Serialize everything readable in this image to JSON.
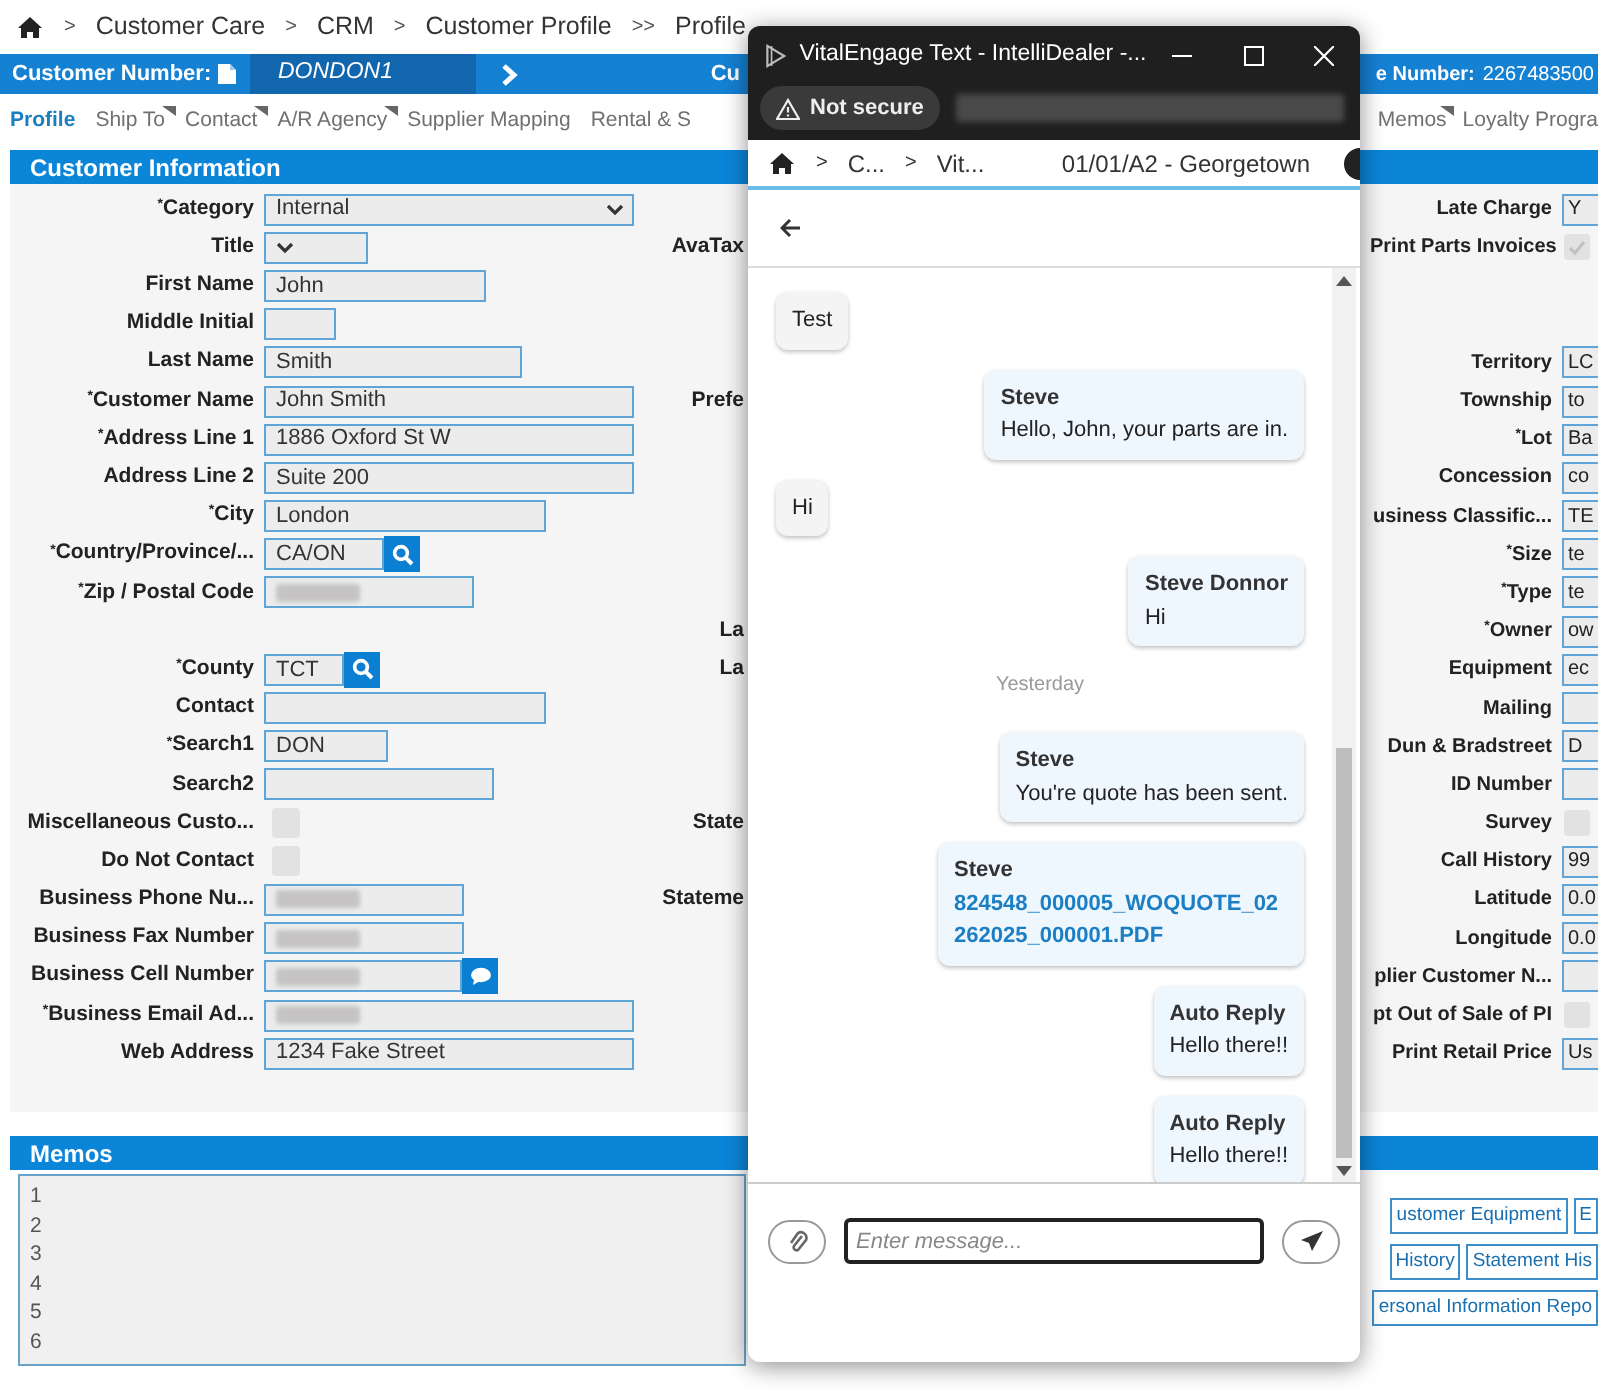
{
  "breadcrumb": [
    {
      "separator": ">",
      "label": "Customer Care"
    },
    {
      "separator": ">",
      "label": "CRM"
    },
    {
      "separator": ">",
      "label": "Customer Profile"
    },
    {
      "separator": ">>",
      "label": "Profile"
    }
  ],
  "customer_bar": {
    "label": "Customer Number:",
    "value": "DONDON1",
    "next_label": "Cu",
    "right_label": "e Number:",
    "right_value": "2267483500"
  },
  "tabs": [
    {
      "label": "Profile",
      "selected": true,
      "has_menu": false
    },
    {
      "label": "Ship To",
      "selected": false,
      "has_menu": true
    },
    {
      "label": "Contact",
      "selected": false,
      "has_menu": true
    },
    {
      "label": "A/R Agency",
      "selected": false,
      "has_menu": true
    },
    {
      "label": "Supplier Mapping",
      "selected": false,
      "has_menu": false
    },
    {
      "label": "Rental & S",
      "selected": false,
      "has_menu": false
    }
  ],
  "tabs_continued": [
    {
      "label": "Memos",
      "selected": false,
      "has_menu": true
    },
    {
      "label": "Loyalty Progra",
      "selected": false,
      "has_menu": false
    }
  ],
  "customer_information": {
    "title": "Customer Information",
    "rows": [
      {
        "left": {
          "label": "$^{*}$Category",
          "kind": "select",
          "value": "Internal"
        },
        "right": {
          "label": "Late Charge",
          "kind": "text",
          "value": "Y"
        }
      },
      {
        "left": {
          "label": "Title",
          "kind": "select"
        },
        "middle": "AvaTax",
        "right": {
          "label": "Print Parts Invoices",
          "kind": "checkbox",
          "checked": true
        }
      },
      {
        "left": {
          "label": "First Name",
          "kind": "text",
          "value": "John"
        }
      },
      {
        "left": {
          "label": "Middle Initial",
          "kind": "text"
        }
      },
      {
        "left": {
          "label": "Last Name",
          "kind": "text",
          "value": "Smith"
        },
        "right": {
          "label": "Territory",
          "kind": "text",
          "value": "LC"
        }
      },
      {
        "left": {
          "label": "$^{*}$Customer Name",
          "kind": "text",
          "value": "John Smith"
        },
        "middle": "Prefe",
        "right": {
          "label": "Township",
          "kind": "text",
          "value": "to"
        }
      },
      {
        "left": {
          "label": "$^{*}$Address Line 1",
          "kind": "text",
          "value": "1886 Oxford St W"
        },
        "right": {
          "label": "$^{*}$Lot",
          "kind": "text",
          "value": "Ba"
        }
      },
      {
        "left": {
          "label": "Address Line 2",
          "kind": "text",
          "value": "Suite 200"
        },
        "right": {
          "label": "Concession",
          "kind": "text",
          "value": "co"
        }
      },
      {
        "left": {
          "label": "$^{*}$City",
          "kind": "text",
          "value": "London"
        },
        "right": {
          "label": "usiness Classific...",
          "kind": "text",
          "value": "TE"
        }
      },
      {
        "left": {
          "label": "$^{*}$Country/Province/...",
          "kind": "lookup",
          "value": "CA/ON"
        },
        "right": {
          "label": "$^{*}$Size",
          "kind": "text",
          "value": "te"
        }
      },
      {
        "left": {
          "label": "$^{*}$Zip / Postal Code",
          "kind": "text",
          "redacted": true
        },
        "right": {
          "label": "$^{*}$Type",
          "kind": "text",
          "value": "te"
        }
      },
      {
        "middle": "La",
        "right": {
          "label": "$^{*}$Owner",
          "kind": "text",
          "value": "ow"
        }
      },
      {
        "left": {
          "label": "$^{*}$County",
          "kind": "lookup",
          "value": "TCT"
        },
        "middle": "La",
        "right": {
          "label": "Equipment",
          "kind": "text",
          "value": "ec"
        }
      },
      {
        "left": {
          "label": "Contact",
          "kind": "text"
        },
        "right": {
          "label": "Mailing",
          "kind": "text"
        }
      },
      {
        "left": {
          "label": "$^{*}$Search1",
          "kind": "text",
          "value": "DON"
        },
        "right": {
          "label": "Dun & Bradstreet",
          "kind": "text",
          "value": "D"
        }
      },
      {
        "left": {
          "label": "Search2",
          "kind": "text"
        },
        "right": {
          "label": "ID Number",
          "kind": "text"
        }
      },
      {
        "left": {
          "label": "Miscellaneous Custo...",
          "kind": "checkbox",
          "checked": false
        },
        "middle": "State",
        "right": {
          "label": "Survey",
          "kind": "checkbox",
          "checked": false
        }
      },
      {
        "left": {
          "label": "Do Not Contact",
          "kind": "checkbox",
          "checked": false
        },
        "right": {
          "label": "Call History",
          "kind": "text",
          "value": "99"
        }
      },
      {
        "left": {
          "label": "Business Phone Nu...",
          "kind": "text",
          "redacted": true
        },
        "middle": "Stateme",
        "right": {
          "label": "Latitude",
          "kind": "text",
          "value": "0.0"
        }
      },
      {
        "left": {
          "label": "Business Fax Number",
          "kind": "text",
          "redacted": true
        },
        "right": {
          "label": "Longitude",
          "kind": "text",
          "value": "0.0"
        }
      },
      {
        "left": {
          "label": "Business Cell Number",
          "kind": "chat",
          "redacted": true
        },
        "right": {
          "label": "plier Customer N...",
          "kind": "text"
        }
      },
      {
        "left": {
          "label": "$^{*}$Business Email Ad...",
          "kind": "text",
          "redacted": true
        },
        "right": {
          "label": "pt Out of Sale of PI",
          "kind": "checkbox",
          "checked": false
        }
      },
      {
        "left": {
          "label": "Web Address",
          "kind": "text",
          "value": "1234 Fake Street"
        },
        "right": {
          "label": "Print Retail Price",
          "kind": "text",
          "value": "Us"
        }
      }
    ]
  },
  "memos": {
    "title": "Memos",
    "line_numbers": [
      "1",
      "2",
      "3",
      "4",
      "5",
      "6"
    ],
    "buttons": [
      [
        "ustomer Equipment",
        "E"
      ],
      [
        "History",
        "Statement His"
      ],
      [
        "ersonal Information Repo"
      ]
    ]
  },
  "popup": {
    "title": "VitalEngage Text - IntelliDealer -...",
    "security": "Not secure",
    "breadcrumb": [
      {
        "separator": ">",
        "label": "C..."
      },
      {
        "separator": ">",
        "label": "Vit..."
      }
    ],
    "location": "01/01/A2 - Georgetown",
    "messages": [
      {
        "kind": "received",
        "text": "Test"
      },
      {
        "kind": "sent",
        "sender": "Steve",
        "text": "Hello, John, your parts are in."
      },
      {
        "kind": "received",
        "text": "Hi"
      },
      {
        "kind": "sent",
        "sender": "Steve Donnor",
        "text": "Hi"
      },
      {
        "kind": "date",
        "text": "Yesterday"
      },
      {
        "kind": "sent",
        "sender": "Steve",
        "text": "You're quote has been sent."
      },
      {
        "kind": "file",
        "sender": "Steve",
        "text": "824548_000005_WOQUOTE_02262025_000001.PDF"
      },
      {
        "kind": "sent",
        "sender": "Auto Reply",
        "text": "Hello there!!"
      },
      {
        "kind": "sent",
        "sender": "Auto Reply",
        "text": "Hello there!!"
      }
    ],
    "input": {
      "placeholder": "Enter message..."
    }
  }
}
